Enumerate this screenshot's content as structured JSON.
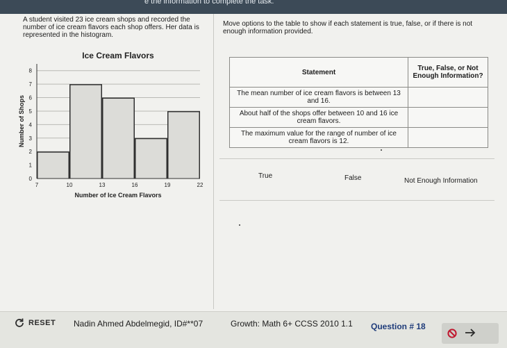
{
  "header": {
    "instructions_tail": "e the information to complete the task."
  },
  "prompt": {
    "left": "A student visited 23 ice cream shops and recorded the number of ice cream flavors each shop offers. Her data is represented in the histogram.",
    "right": "Move options to the table to show if each statement is true, false, or if there is not enough information provided."
  },
  "chart_data": {
    "type": "bar",
    "title": "Ice Cream Flavors",
    "xlabel": "Number of Ice Cream Flavors",
    "ylabel": "Number of Shops",
    "bin_edges": [
      7,
      10,
      13,
      16,
      19,
      22
    ],
    "values": [
      2,
      7,
      6,
      3,
      5
    ],
    "x_tick_labels": [
      "7",
      "10",
      "13",
      "16",
      "19",
      "22"
    ],
    "y_tick_labels": [
      "0",
      "1",
      "2",
      "3",
      "4",
      "5",
      "6",
      "7",
      "8"
    ],
    "xlim": [
      7,
      22
    ],
    "ylim": [
      0,
      8.5
    ],
    "grid": true,
    "colors": {
      "bar": "#2f2f2f",
      "grid": "#b9b9b4"
    }
  },
  "table": {
    "header_statement": "Statement",
    "header_answer": "True, False, or Not Enough Information?",
    "rows": [
      {
        "statement": "The mean number of ice cream flavors is between 13 and 16.",
        "answer": ""
      },
      {
        "statement": "About half of the shops offer between 10 and 16 ice cream flavors.",
        "answer": ""
      },
      {
        "statement": "The maximum value for the range of number of ice cream flavors is 12.",
        "answer": ""
      }
    ]
  },
  "options": {
    "true_label": "True",
    "false_label": "False",
    "nei_label": "Not Enough Information"
  },
  "footer": {
    "reset_label": "RESET",
    "student": "Nadin Ahmed Abdelmegid, ID#**07",
    "assessment": "Growth: Math 6+ CCSS 2010 1.1",
    "question": "Question # 18",
    "icons": {
      "reset": "refresh-icon",
      "flag": "no-entry-icon",
      "next": "arrow-right-icon"
    },
    "colors": {
      "question": "#1f3c7a",
      "flag": "#c0182f"
    }
  }
}
